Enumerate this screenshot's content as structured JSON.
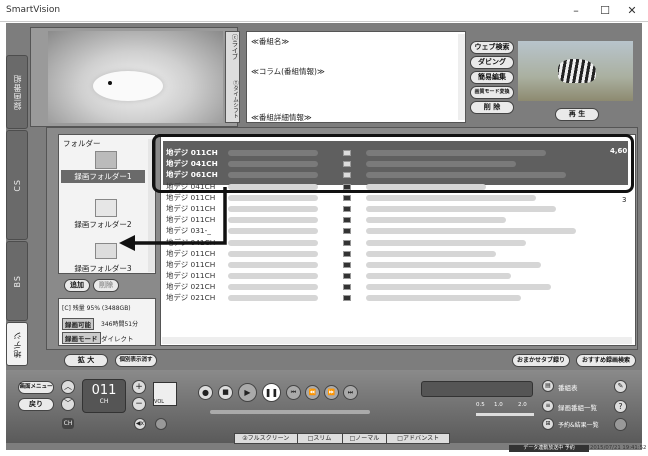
{
  "window": {
    "title": "SmartVision",
    "min": "–",
    "max": "☐",
    "close": "✕"
  },
  "left_tabs": [
    {
      "label": "録画番組"
    },
    {
      "label": "CS"
    },
    {
      "label": "BS"
    },
    {
      "label": "地デジ"
    }
  ],
  "info": {
    "tab_label": "ⓒライブ",
    "tab2_label": "Ⓣタイムシフト",
    "program_name": "≪番組名≫",
    "column": "≪コラム(番組情報)≫",
    "details": "≪番組詳細情報≫"
  },
  "right_buttons": [
    "ウェブ検索",
    "ダビング",
    "簡易編集",
    "画質モード変換",
    "削 除"
  ],
  "play_label": "再 生",
  "folders": {
    "header": "フォルダー",
    "items": [
      "録画フォルダー1",
      "録画フォルダー2",
      "録画フォルダー3"
    ],
    "add": "追加",
    "del": "削除"
  },
  "disk": {
    "usage": "[C] 残量 95% (3488GB)",
    "recordable_label": "録画可能",
    "recordable_value": "346時間51分",
    "mode_label": "録画モード",
    "mode_value": "ダイレクト"
  },
  "bottom_left": {
    "enlarge": "拡 大",
    "hide": "個別表示消す"
  },
  "bottom_right": {
    "omakase": "おまかせタブ録り",
    "recommend": "おすすめ録画検索"
  },
  "list": {
    "selected": [
      "地デジ 011CH",
      "地デジ 041CH",
      "地デジ 061CH"
    ],
    "rows": [
      "地デジ 041CH",
      "地デジ 011CH",
      "地デジ 011CH",
      "地デジ 011CH",
      "地デジ 031-_",
      "地デジ 041CH",
      "地デジ 011CH",
      "地デジ 011CH",
      "地デジ 011CH",
      "地デジ 021CH",
      "地デジ 021CH"
    ],
    "right_val_1": "4,60",
    "right_val_2": "3"
  },
  "controls": {
    "menu": "画面メニュー",
    "back": "戻り",
    "channel": "011",
    "ch": "CH",
    "vol": "VOL",
    "ch_label": "CH"
  },
  "speed": {
    "s05": "0.5",
    "s10": "1.0",
    "s20": "2.0"
  },
  "right_controls": {
    "guide": "番組表",
    "recorded": "録画番組一覧",
    "reservation": "予約&結果一覧"
  },
  "view_modes": [
    "②フルスクリーン",
    "□スリム",
    "□ノーマル",
    "□アドバンスト"
  ],
  "status": {
    "text": "データ連動放送中 予約",
    "datetime": "2015/07/21 19:41:52"
  },
  "colors": {
    "accent": "#5f5f5f",
    "panel": "#7d7d7d"
  }
}
